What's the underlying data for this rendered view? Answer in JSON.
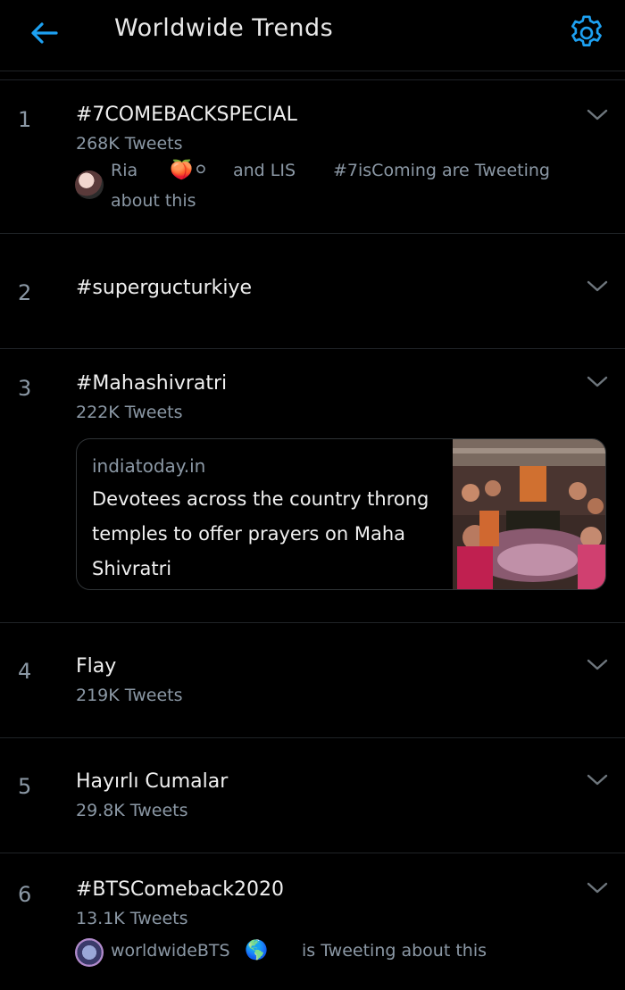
{
  "header": {
    "title": "Worldwide Trends",
    "back_icon": "arrow-left-icon",
    "settings_icon": "gear-icon",
    "accent_color": "#1da1f2"
  },
  "trends": [
    {
      "rank": "1",
      "name": "#7COMEBACKSPECIAL",
      "count": "268K Tweets",
      "context": {
        "user": "Ria",
        "emoji": "🍑⚪",
        "and": "and LIS",
        "hashtag": "#7isComing are Tweeting",
        "rest": "about this"
      }
    },
    {
      "rank": "2",
      "name": "#supergucturkiye"
    },
    {
      "rank": "3",
      "name": "#Mahashivratri",
      "count": "222K Tweets",
      "card": {
        "domain": "indiatoday.in",
        "headline": "Devotees across the country throng temples to offer prayers on Maha Shivratri",
        "image_icon": "temple-crowd-photo"
      }
    },
    {
      "rank": "4",
      "name": "Flay",
      "count": "219K Tweets"
    },
    {
      "rank": "5",
      "name": "Hayırlı Cumalar",
      "count": "29.8K Tweets"
    },
    {
      "rank": "6",
      "name": "#BTSComeback2020",
      "count": "13.1K Tweets",
      "context": {
        "user": "worldwideBTS",
        "emoji": "🌎",
        "rest": "is Tweeting about this"
      }
    }
  ]
}
